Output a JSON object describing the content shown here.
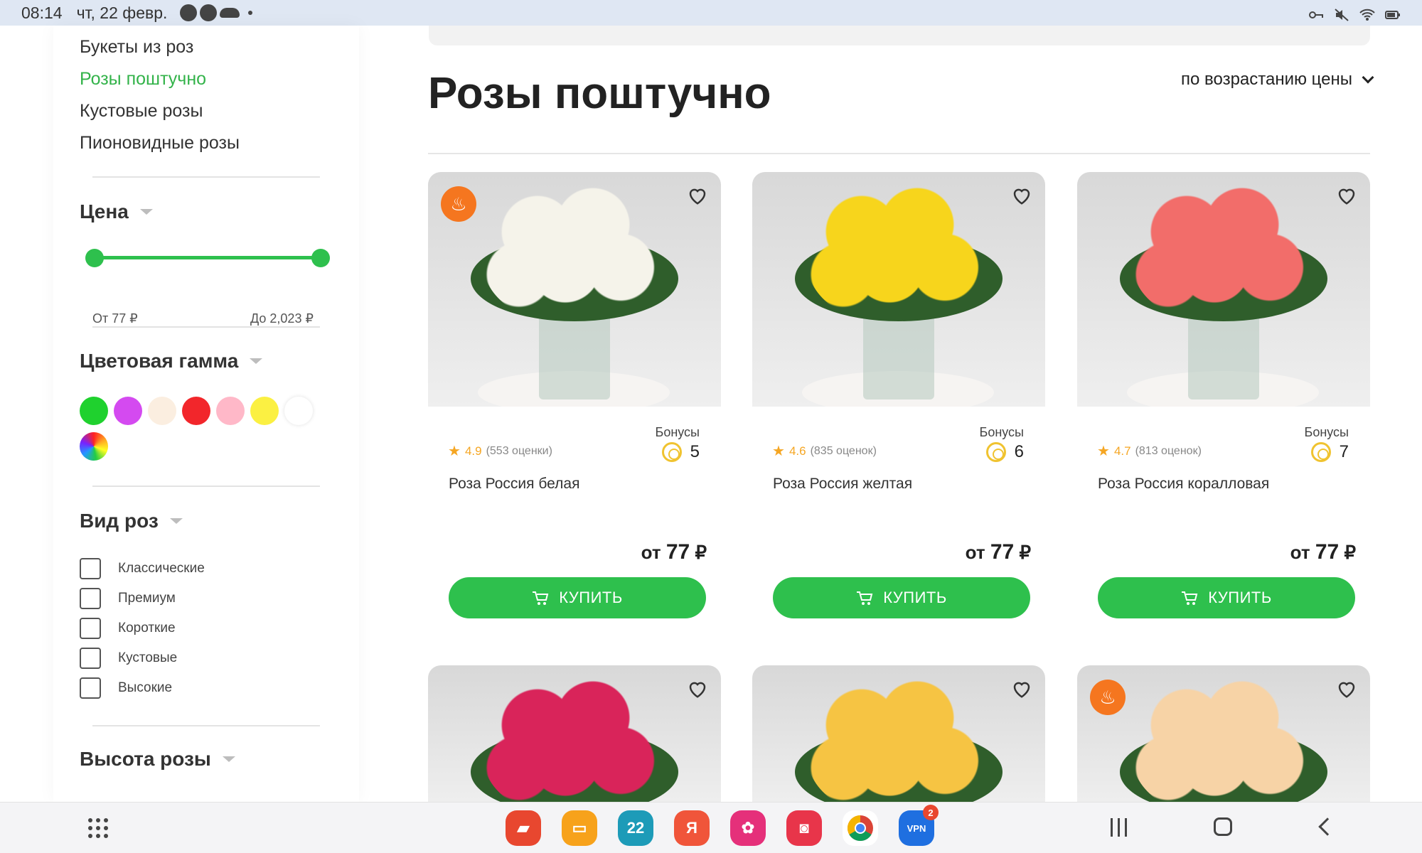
{
  "status_bar": {
    "time": "08:14",
    "date": "чт, 22 февр."
  },
  "sidebar": {
    "categories": [
      {
        "label": "Букеты из роз",
        "active": false
      },
      {
        "label": "Розы поштучно",
        "active": true
      },
      {
        "label": "Кустовые розы",
        "active": false
      },
      {
        "label": "Пионовидные розы",
        "active": false
      }
    ],
    "price_filter": {
      "title": "Цена",
      "from_label": "От  77  ₽",
      "to_label": "До  2,023  ₽"
    },
    "color_filter": {
      "title": "Цветовая гамма",
      "colors": [
        "#1fd12e",
        "#d44af0",
        "#fbeee0",
        "#f2262b",
        "#ffb8c8",
        "#fbf042",
        "#ffffff",
        "rainbow"
      ]
    },
    "type_filter": {
      "title": "Вид роз",
      "options": [
        "Классические",
        "Премиум",
        "Короткие",
        "Кустовые",
        "Высокие"
      ]
    },
    "height_filter": {
      "title": "Высота розы"
    }
  },
  "main": {
    "title": "Розы поштучно",
    "sort_label": "по возрастанию цены",
    "buy_label": "КУПИТЬ",
    "bonus_label": "Бонусы",
    "price_prefix": "от",
    "currency": "₽",
    "products": [
      {
        "name": "Роза Россия белая",
        "rating": "4.9",
        "reviews": "(553 оценки)",
        "bonus": "5",
        "price": "77",
        "hot": true,
        "flower_color": "#f5f3ea"
      },
      {
        "name": "Роза Россия желтая",
        "rating": "4.6",
        "reviews": "(835 оценок)",
        "bonus": "6",
        "price": "77",
        "hot": false,
        "flower_color": "#f7d51c"
      },
      {
        "name": "Роза Россия коралловая",
        "rating": "4.7",
        "reviews": "(813 оценок)",
        "bonus": "7",
        "price": "77",
        "hot": false,
        "flower_color": "#f26d6a"
      }
    ],
    "products_row2": [
      {
        "hot": false,
        "flower_color": "#d9245a"
      },
      {
        "hot": false,
        "flower_color": "#f6c443"
      },
      {
        "hot": true,
        "flower_color": "#f7d3a6"
      }
    ]
  },
  "nav_bar": {
    "apps": [
      {
        "name": "notes-app",
        "color": "#e8472f",
        "glyph": "▰"
      },
      {
        "name": "files-app",
        "color": "#f7a21b",
        "glyph": "▭"
      },
      {
        "name": "calendar-app",
        "color": "#1d9bb8",
        "glyph": "22"
      },
      {
        "name": "yandex-app",
        "color": "#f0553a",
        "glyph": "Я"
      },
      {
        "name": "gallery-app",
        "color": "#e5307a",
        "glyph": "✿"
      },
      {
        "name": "camera-app",
        "color": "#e8354a",
        "glyph": "◙"
      },
      {
        "name": "chrome-app",
        "color": "#ffffff",
        "glyph": ""
      },
      {
        "name": "vpn-app",
        "color": "#1f6fe0",
        "glyph": "VPN",
        "badge": "2"
      }
    ]
  }
}
